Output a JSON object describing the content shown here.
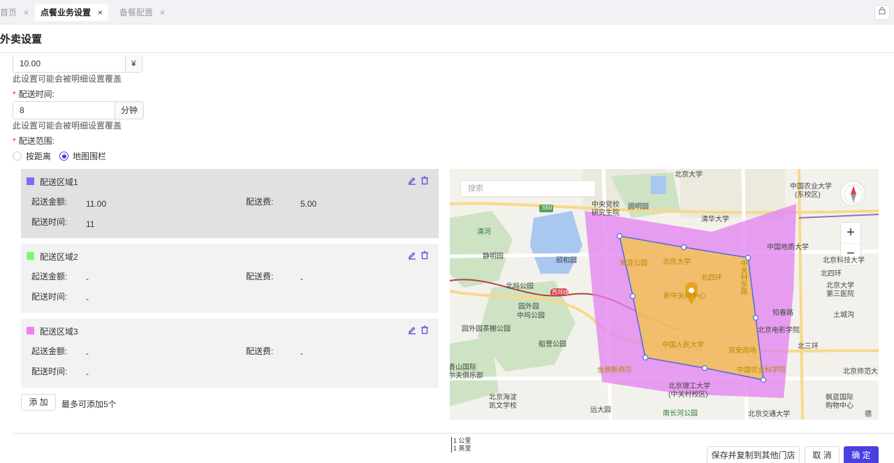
{
  "tabs": [
    {
      "label": "首页",
      "active": false
    },
    {
      "label": "点餐业务设置",
      "active": true
    },
    {
      "label": "备餐配置",
      "active": false
    }
  ],
  "tab_close": "×",
  "page_title": "外卖设置",
  "fee_field": {
    "value": "10.00",
    "suffix": "¥"
  },
  "override_hint": "此设置可能会被明细设置覆盖",
  "delivery_time": {
    "label": "配送时间:",
    "value": "8",
    "suffix": "分钟"
  },
  "delivery_range": {
    "label": "配送范围:",
    "options": [
      "按距离",
      "地图围栏"
    ],
    "selected": "地图围栏"
  },
  "zone_labels": {
    "min_order": "起送金额:",
    "fee": "配送费:",
    "time": "配送时间:"
  },
  "zones": [
    {
      "name": "配送区域1",
      "color": "#7b6ef6",
      "min_order": "11.00",
      "fee": "5.00",
      "time": "11"
    },
    {
      "name": "配送区域2",
      "color": "#7bf57b",
      "min_order": "-",
      "fee": "-",
      "time": "-"
    },
    {
      "name": "配送区域3",
      "color": "#f07ff0",
      "min_order": "-",
      "fee": "-",
      "time": "-"
    }
  ],
  "add_button": "添 加",
  "add_note": "最多可添加5个",
  "map": {
    "search_placeholder": "搜索",
    "zoom_in": "+",
    "zoom_out": "−",
    "labels": {
      "l1": "中国农业大学",
      "l2": "(东校区)",
      "l3": "北京大学",
      "l4": "清华大学",
      "l5": "中央党校",
      "l6": "研究生院",
      "l7": "圆明园",
      "l8": "清河",
      "l9": "静明园",
      "l10": "颐和园",
      "l11": "海淀公园",
      "l12": "北四环",
      "l13": "中国地质大学",
      "l14": "北京科技大学",
      "l15": "北坞公园",
      "l16": "新中关村中心",
      "l17": "园外园",
      "l18": "中坞公园",
      "l19": "知春路",
      "l20": "北京电影学院",
      "l21": "土城沟",
      "l22": "园外园茶棚公园",
      "l23": "船营公园",
      "l24": "中国人民大学",
      "l25": "双安商场",
      "l26": "北三环",
      "l27": "北京大学",
      "l28": "第三医院",
      "l29": "香山国际",
      "l30": "尔夫俱乐部",
      "l31": "金源新燕莎",
      "l32": "中国农业科学院",
      "l33": "北京师范大",
      "l34": "北京海淀",
      "l35": "凯文学校",
      "l36": "远大园",
      "l37": "北京理工大学",
      "l38": "(中关村校区)",
      "l39": "枫蓝国际",
      "l40": "购物中心",
      "l41": "南长河公园",
      "l42": "北京交通大学",
      "l43": "中关村东路",
      "l44": "北四环",
      "l45": "西郊线",
      "l46": "S50",
      "l47": "德"
    },
    "scale_km": "1 公里",
    "scale_mi": "1 英里"
  },
  "footer": {
    "copy_button": "保存并复制到其他门店",
    "cancel_button": "取 消",
    "confirm_button": "确 定"
  },
  "colors": {
    "primary": "#4a3fe0",
    "fence_yellow": "#f5c842",
    "fence_pink": "#e27ff0"
  }
}
